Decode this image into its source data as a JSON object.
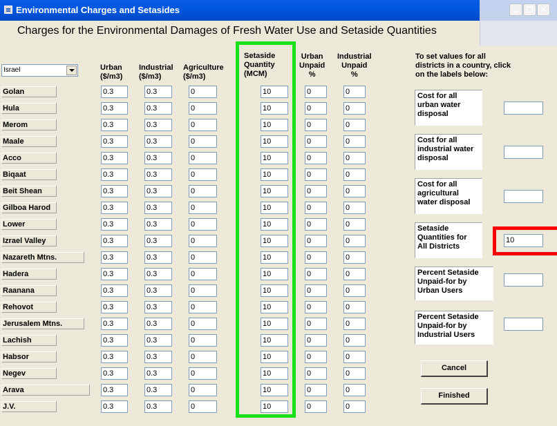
{
  "window": {
    "title": "Environmental Charges and Setasides",
    "heading": "Charges for the Environmental Damages of Fresh Water Use and Setaside Quantities"
  },
  "country_select": {
    "selected": "Israel"
  },
  "columns": {
    "urban": [
      "Urban",
      "($/m3)"
    ],
    "industrial": [
      "Industrial",
      "($/m3)"
    ],
    "agriculture": [
      "Agriculture",
      "($/m3)"
    ],
    "setaside": [
      "Setaside",
      "Quantity",
      "(MCM)"
    ],
    "urban_unpaid": [
      "Urban",
      "Unpaid",
      "%"
    ],
    "industrial_unpaid": [
      "Industrial",
      "Unpaid",
      "%"
    ]
  },
  "rows": [
    {
      "district": "Golan",
      "urban": "0.3",
      "industrial": "0.3",
      "agriculture": "0",
      "setaside": "10",
      "urban_unpaid": "0",
      "industrial_unpaid": "0"
    },
    {
      "district": "Hula",
      "urban": "0.3",
      "industrial": "0.3",
      "agriculture": "0",
      "setaside": "10",
      "urban_unpaid": "0",
      "industrial_unpaid": "0"
    },
    {
      "district": "Merom",
      "urban": "0.3",
      "industrial": "0.3",
      "agriculture": "0",
      "setaside": "10",
      "urban_unpaid": "0",
      "industrial_unpaid": "0"
    },
    {
      "district": "Maale",
      "urban": "0.3",
      "industrial": "0.3",
      "agriculture": "0",
      "setaside": "10",
      "urban_unpaid": "0",
      "industrial_unpaid": "0"
    },
    {
      "district": "Acco",
      "urban": "0.3",
      "industrial": "0.3",
      "agriculture": "0",
      "setaside": "10",
      "urban_unpaid": "0",
      "industrial_unpaid": "0"
    },
    {
      "district": "Biqaat",
      "urban": "0.3",
      "industrial": "0.3",
      "agriculture": "0",
      "setaside": "10",
      "urban_unpaid": "0",
      "industrial_unpaid": "0"
    },
    {
      "district": "Beit Shean",
      "urban": "0.3",
      "industrial": "0.3",
      "agriculture": "0",
      "setaside": "10",
      "urban_unpaid": "0",
      "industrial_unpaid": "0"
    },
    {
      "district": "Gilboa Harod",
      "urban": "0.3",
      "industrial": "0.3",
      "agriculture": "0",
      "setaside": "10",
      "urban_unpaid": "0",
      "industrial_unpaid": "0"
    },
    {
      "district": "Lower",
      "urban": "0.3",
      "industrial": "0.3",
      "agriculture": "0",
      "setaside": "10",
      "urban_unpaid": "0",
      "industrial_unpaid": "0"
    },
    {
      "district": "Izrael Valley",
      "urban": "0.3",
      "industrial": "0.3",
      "agriculture": "0",
      "setaside": "10",
      "urban_unpaid": "0",
      "industrial_unpaid": "0"
    },
    {
      "district": "Nazareth Mtns.",
      "urban": "0.3",
      "industrial": "0.3",
      "agriculture": "0",
      "setaside": "10",
      "urban_unpaid": "0",
      "industrial_unpaid": "0"
    },
    {
      "district": "Hadera",
      "urban": "0.3",
      "industrial": "0.3",
      "agriculture": "0",
      "setaside": "10",
      "urban_unpaid": "0",
      "industrial_unpaid": "0"
    },
    {
      "district": "Raanana",
      "urban": "0.3",
      "industrial": "0.3",
      "agriculture": "0",
      "setaside": "10",
      "urban_unpaid": "0",
      "industrial_unpaid": "0"
    },
    {
      "district": "Rehovot",
      "urban": "0.3",
      "industrial": "0.3",
      "agriculture": "0",
      "setaside": "10",
      "urban_unpaid": "0",
      "industrial_unpaid": "0"
    },
    {
      "district": "Jerusalem Mtns.",
      "urban": "0.3",
      "industrial": "0.3",
      "agriculture": "0",
      "setaside": "10",
      "urban_unpaid": "0",
      "industrial_unpaid": "0"
    },
    {
      "district": "Lachish",
      "urban": "0.3",
      "industrial": "0.3",
      "agriculture": "0",
      "setaside": "10",
      "urban_unpaid": "0",
      "industrial_unpaid": "0"
    },
    {
      "district": "Habsor",
      "urban": "0.3",
      "industrial": "0.3",
      "agriculture": "0",
      "setaside": "10",
      "urban_unpaid": "0",
      "industrial_unpaid": "0"
    },
    {
      "district": "Negev",
      "urban": "0.3",
      "industrial": "0.3",
      "agriculture": "0",
      "setaside": "10",
      "urban_unpaid": "0",
      "industrial_unpaid": "0"
    },
    {
      "district": "Arava",
      "urban": "0.3",
      "industrial": "0.3",
      "agriculture": "0",
      "setaside": "10",
      "urban_unpaid": "0",
      "industrial_unpaid": "0"
    },
    {
      "district": "J.V.",
      "urban": "0.3",
      "industrial": "0.3",
      "agriculture": "0",
      "setaside": "10",
      "urban_unpaid": "0",
      "industrial_unpaid": "0"
    }
  ],
  "side_panel": {
    "help": [
      "To set values for all",
      "districts in a country, click",
      "on the labels below:"
    ],
    "items": [
      {
        "label": [
          "Cost for all",
          "urban water",
          "disposal"
        ],
        "value": ""
      },
      {
        "label": [
          "Cost for all",
          "industrial water",
          "disposal"
        ],
        "value": ""
      },
      {
        "label": [
          "Cost for all",
          "agricultural",
          "water disposal"
        ],
        "value": ""
      },
      {
        "label": [
          "Setaside",
          "Quantities for",
          "All Districts"
        ],
        "value": "10"
      },
      {
        "label": [
          "Percent Setaside",
          "Unpaid-for by",
          "Urban Users"
        ],
        "value": ""
      },
      {
        "label": [
          "Percent Setaside",
          "Unpaid-for by",
          "Industrial Users"
        ],
        "value": ""
      }
    ]
  },
  "buttons": {
    "cancel": "Cancel",
    "finished": "Finished"
  },
  "highlights": {
    "setaside_column": "#19e019",
    "setaside_all_input": "#ff0000"
  }
}
